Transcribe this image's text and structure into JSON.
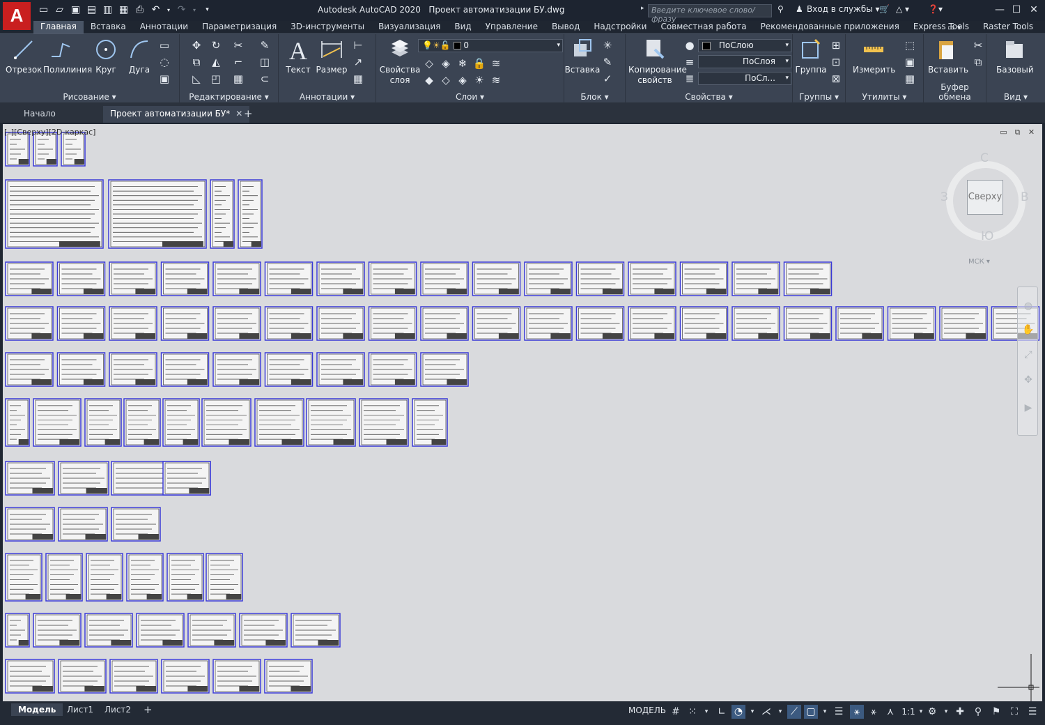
{
  "titlebar": {
    "logo": "A",
    "app": "Autodesk AutoCAD 2020",
    "file": "Проект автоматизации БУ.dwg",
    "search_placeholder": "Введите ключевое слово/фразу",
    "signin": "Вход в службы",
    "qat_icons": [
      "new-icon",
      "open-icon",
      "save-icon",
      "save-as-icon",
      "publish-icon",
      "plot-preview-icon",
      "print-icon",
      "undo-icon",
      "redo-icon",
      "customize-icon"
    ]
  },
  "ribbon_tabs": [
    "Главная",
    "Вставка",
    "Аннотации",
    "Параметризация",
    "3D-инструменты",
    "Визуализация",
    "Вид",
    "Управление",
    "Вывод",
    "Надстройки",
    "Совместная работа",
    "Рекомендованные приложения",
    "Express Tools",
    "Raster Tools"
  ],
  "ribbon": {
    "draw": {
      "title": "Рисование",
      "line": "Отрезок",
      "polyline": "Полилиния",
      "circle": "Круг",
      "arc": "Дуга"
    },
    "modify": {
      "title": "Редактирование"
    },
    "annotation": {
      "title": "Аннотации",
      "text": "Текст",
      "dimension": "Размер"
    },
    "layers": {
      "title": "Слои",
      "properties": "Свойства",
      "properties2": "слоя",
      "current_layer": "0"
    },
    "block": {
      "title": "Блок",
      "insert": "Вставка"
    },
    "properties": {
      "title": "Свойства",
      "match": "Копирование",
      "match2": "свойств",
      "color": "ПоСлою",
      "linetype": "ПоСлоя",
      "lineweight": "ПоСл..."
    },
    "groups": {
      "title": "Группы",
      "group": "Группа"
    },
    "utilities": {
      "title": "Утилиты",
      "measure": "Измерить"
    },
    "clipboard": {
      "title": "Буфер обмена",
      "paste": "Вставить"
    },
    "view": {
      "title": "Вид",
      "base": "Базовый"
    }
  },
  "filetabs": {
    "start": "Начало",
    "doc": "Проект автоматизации БУ*"
  },
  "viewport": {
    "label": "[–][Сверху][2D-каркас]",
    "viewcube_face": "Сверху",
    "north": "С",
    "south": "Ю",
    "west": "З",
    "east": "В",
    "wcs": "МСК"
  },
  "layout_tabs": [
    "Модель",
    "Лист1",
    "Лист2"
  ],
  "status": {
    "model": "МОДЕЛЬ",
    "scale": "1:1"
  },
  "colors": {
    "accent": "#3c5a80",
    "sheet_border": "#3a3ad6",
    "canvas": "#d9dadd"
  }
}
